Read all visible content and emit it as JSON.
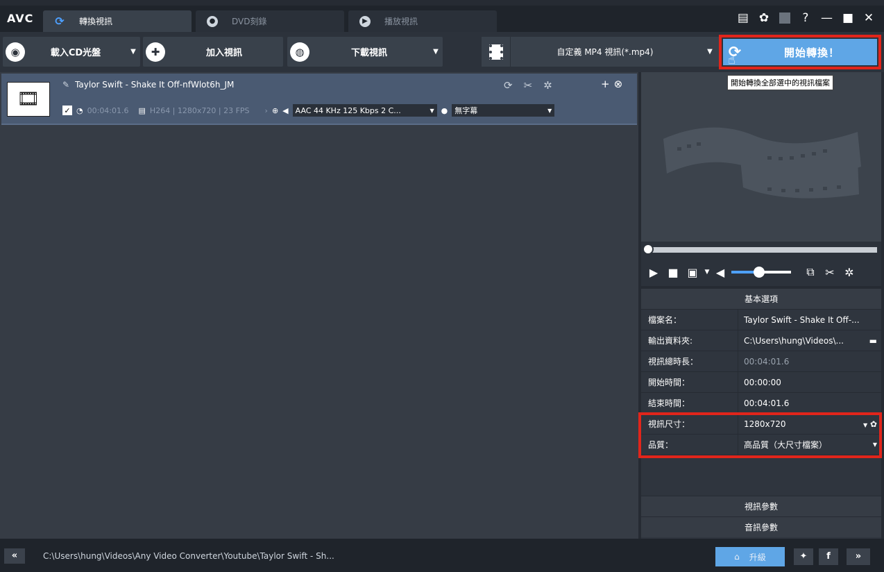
{
  "app": {
    "logo": "AVC"
  },
  "tabs": [
    {
      "label": "轉換視訊",
      "icon": "refresh-icon",
      "active": true
    },
    {
      "label": "DVD刻錄",
      "icon": "disc-icon",
      "active": false
    },
    {
      "label": "播放視訊",
      "icon": "play-icon",
      "active": false
    }
  ],
  "window_controls": {
    "menu": "▤",
    "settings": "✿",
    "help": "?",
    "minimize": "—",
    "maximize": "■",
    "close": "✕"
  },
  "toolbar": {
    "load_cd": "載入CD光盤",
    "add_video": "加入視訊",
    "download_video": "下載視訊",
    "format": "自定義 MP4 視訊(*.mp4)",
    "start": "開始轉換！"
  },
  "tooltip": "開始轉換全部選中的視訊檔案",
  "file_item": {
    "title": "Taylor Swift - Shake It Off-nfWlot6h_JM",
    "duration": "00:04:01.6",
    "video_info": "H264 | 1280x720 | 23 FPS",
    "audio": "AAC 44 KHz 125 Kbps 2 C...",
    "subtitle": "無字幕"
  },
  "props": {
    "header": "基本選項",
    "rows": [
      {
        "label": "檔案名：",
        "value": "Taylor Swift - Shake It Off-..."
      },
      {
        "label": "輸出資料夾:",
        "value": "C:\\Users\\hung\\Videos\\..."
      },
      {
        "label": "視訊總時長：",
        "value": "00:04:01.6"
      },
      {
        "label": "開始時間：",
        "value": "00:00:00"
      },
      {
        "label": "結束時間：",
        "value": "00:04:01.6"
      },
      {
        "label": "視訊尺寸：",
        "value": "1280x720"
      },
      {
        "label": "品質：",
        "value": "高品質（大尺寸檔案）"
      }
    ],
    "video_params": "視訊參數",
    "audio_params": "音訊參數"
  },
  "volume_level": 0.46,
  "status": {
    "path": "C:\\Users\\hung\\Videos\\Any Video Converter\\Youtube\\Taylor Swift - Sh...",
    "upgrade": "升級",
    "back": "«",
    "forward": "»"
  },
  "colors": {
    "accent": "#5fa6e6",
    "highlight": "#e1251b",
    "selected_row": "#4a5a72"
  }
}
